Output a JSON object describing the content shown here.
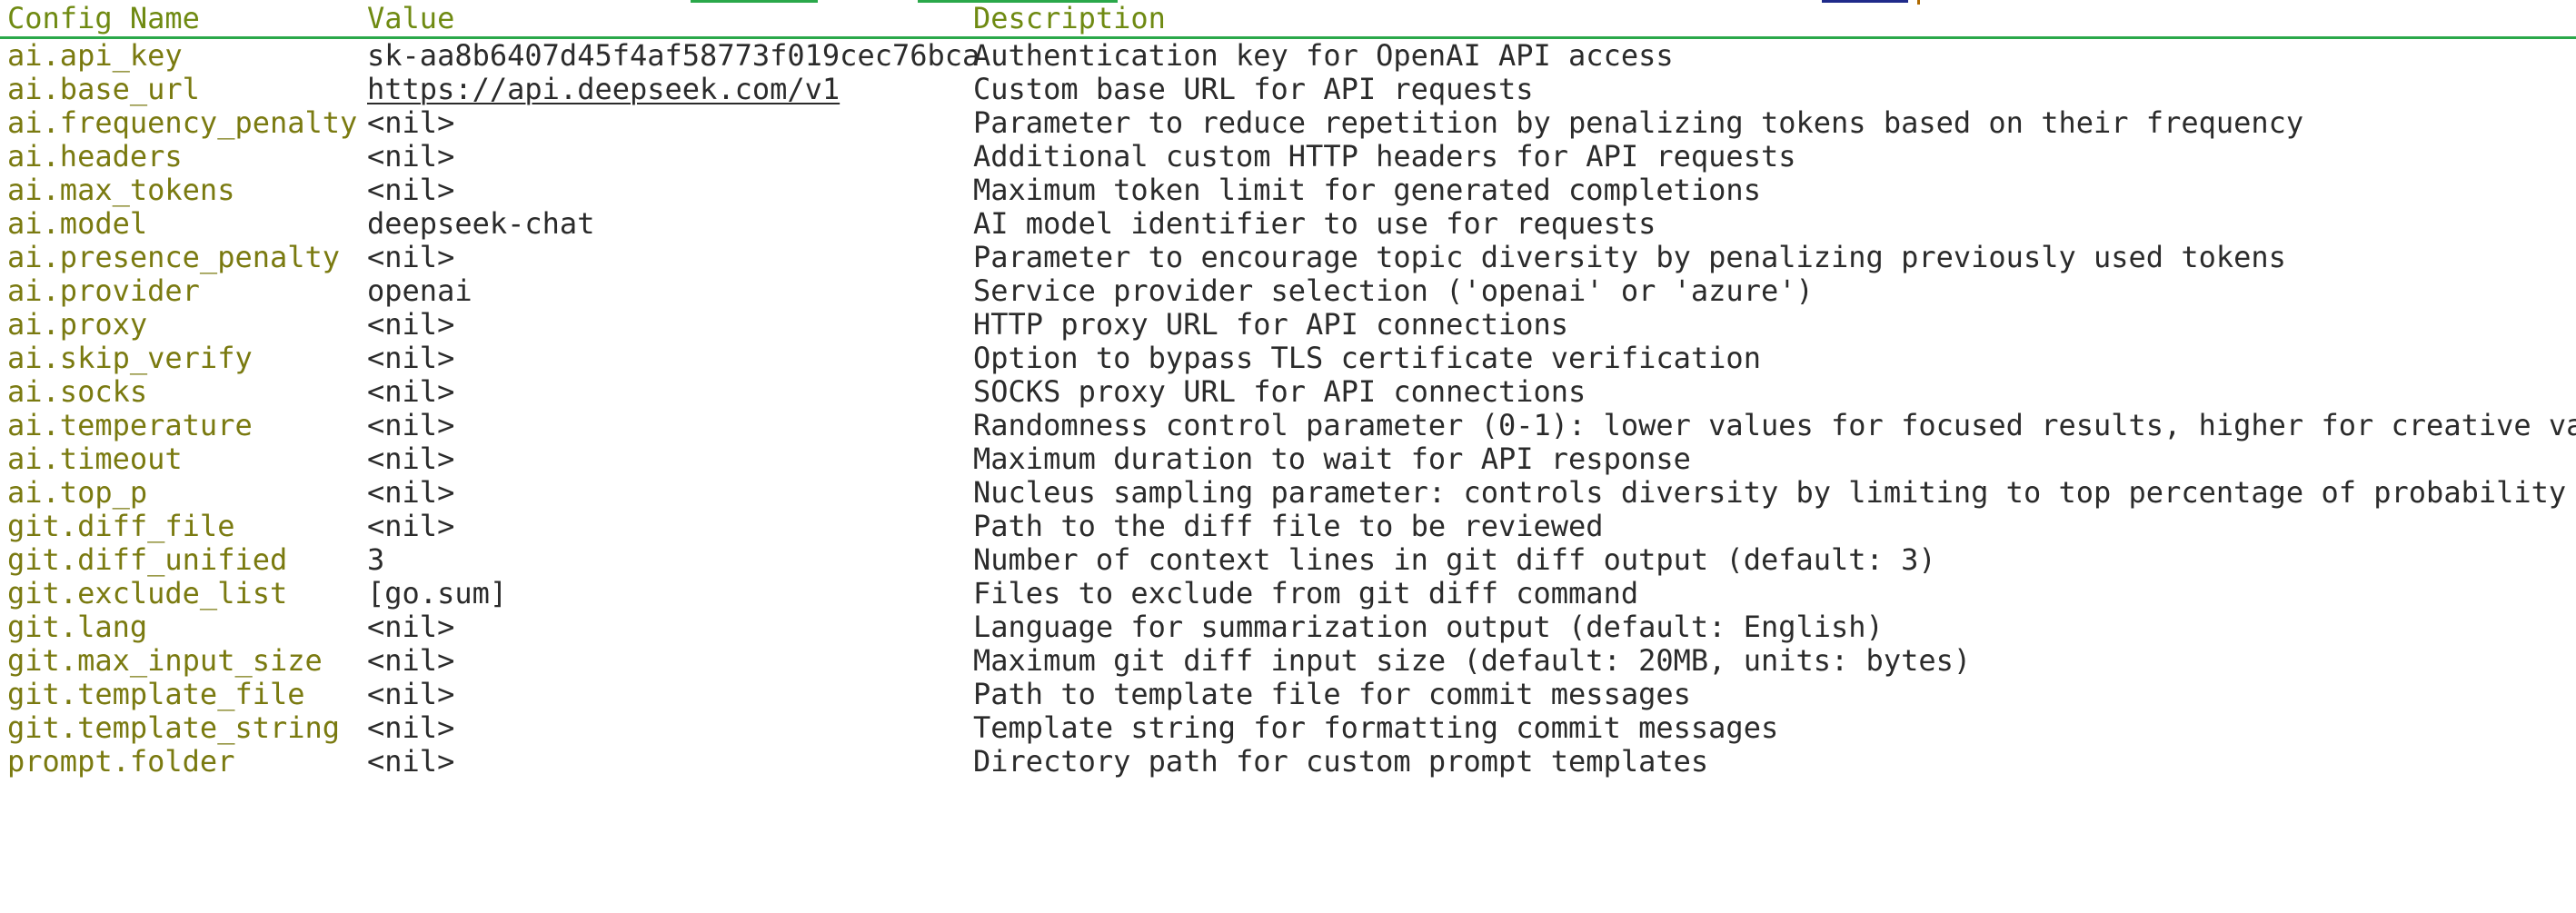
{
  "table": {
    "headers": {
      "name": "Config Name",
      "value": "Value",
      "description": "Description"
    },
    "rows": [
      {
        "name": "ai.api_key",
        "value": "sk-aa8b6407d45f4af58773f019cec76bca",
        "description": "Authentication key for OpenAI API access"
      },
      {
        "name": "ai.base_url",
        "value": "https://api.deepseek.com/v1",
        "description": "Custom base URL for API requests"
      },
      {
        "name": "ai.frequency_penalty",
        "value": "<nil>",
        "description": "Parameter to reduce repetition by penalizing tokens based on their frequency"
      },
      {
        "name": "ai.headers",
        "value": "<nil>",
        "description": "Additional custom HTTP headers for API requests"
      },
      {
        "name": "ai.max_tokens",
        "value": "<nil>",
        "description": "Maximum token limit for generated completions"
      },
      {
        "name": "ai.model",
        "value": "deepseek-chat",
        "description": "AI model identifier to use for requests"
      },
      {
        "name": "ai.presence_penalty",
        "value": "<nil>",
        "description": "Parameter to encourage topic diversity by penalizing previously used tokens"
      },
      {
        "name": "ai.provider",
        "value": "openai",
        "description": "Service provider selection ('openai' or 'azure')"
      },
      {
        "name": "ai.proxy",
        "value": "<nil>",
        "description": "HTTP proxy URL for API connections"
      },
      {
        "name": "ai.skip_verify",
        "value": "<nil>",
        "description": "Option to bypass TLS certificate verification"
      },
      {
        "name": "ai.socks",
        "value": "<nil>",
        "description": "SOCKS proxy URL for API connections"
      },
      {
        "name": "ai.temperature",
        "value": "<nil>",
        "description": "Randomness control parameter (0-1): lower values for focused results, higher for creative variety"
      },
      {
        "name": "ai.timeout",
        "value": "<nil>",
        "description": "Maximum duration to wait for API response"
      },
      {
        "name": "ai.top_p",
        "value": "<nil>",
        "description": "Nucleus sampling parameter: controls diversity by limiting to top percentage of probability mass"
      },
      {
        "name": "git.diff_file",
        "value": "<nil>",
        "description": "Path to the diff file to be reviewed"
      },
      {
        "name": "git.diff_unified",
        "value": "3",
        "description": "Number of context lines in git diff output (default: 3)"
      },
      {
        "name": "git.exclude_list",
        "value": "[go.sum]",
        "description": "Files to exclude from git diff command"
      },
      {
        "name": "git.lang",
        "value": "<nil>",
        "description": "Language for summarization output (default: English)"
      },
      {
        "name": "git.max_input_size",
        "value": "<nil>",
        "description": "Maximum git diff input size (default: 20MB, units: bytes)"
      },
      {
        "name": "git.template_file",
        "value": "<nil>",
        "description": "Path to template file for commit messages"
      },
      {
        "name": "git.template_string",
        "value": "<nil>",
        "description": "Template string for formatting commit messages"
      },
      {
        "name": "prompt.folder",
        "value": "<nil>",
        "description": "Directory path for custom prompt templates"
      }
    ]
  }
}
